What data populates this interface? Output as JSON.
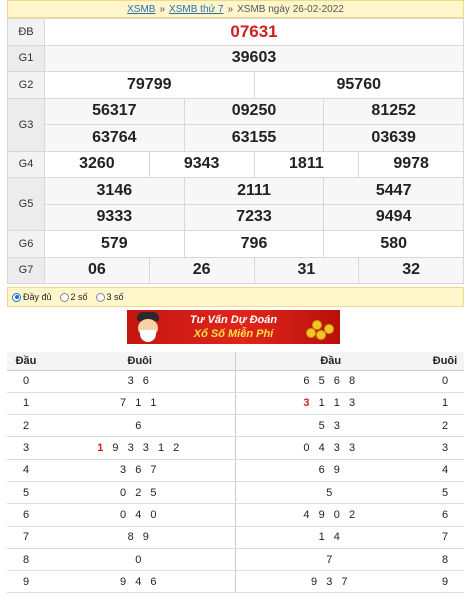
{
  "breadcrumb": {
    "link1": "XSMB",
    "sep1": "»",
    "link2": "XSMB thứ 7",
    "sep2": "»",
    "current": "XSMB ngày 26-02-2022"
  },
  "results": {
    "db": {
      "label": "ĐB",
      "values": [
        "07631"
      ]
    },
    "g1": {
      "label": "G1",
      "values": [
        "39603"
      ]
    },
    "g2": {
      "label": "G2",
      "values": [
        "79799",
        "95760"
      ]
    },
    "g3": {
      "label": "G3",
      "row1": [
        "56317",
        "09250",
        "81252"
      ],
      "row2": [
        "63764",
        "63155",
        "03639"
      ]
    },
    "g4": {
      "label": "G4",
      "values": [
        "3260",
        "9343",
        "1811",
        "9978"
      ]
    },
    "g5": {
      "label": "G5",
      "row1": [
        "3146",
        "2111",
        "5447"
      ],
      "row2": [
        "9333",
        "7233",
        "9494"
      ]
    },
    "g6": {
      "label": "G6",
      "values": [
        "579",
        "796",
        "580"
      ]
    },
    "g7": {
      "label": "G7",
      "values": [
        "06",
        "26",
        "31",
        "32"
      ]
    }
  },
  "options": [
    {
      "label": "Đầy đủ",
      "selected": true
    },
    {
      "label": "2 số",
      "selected": false
    },
    {
      "label": "3 số",
      "selected": false
    }
  ],
  "banner": {
    "line1": "Tư Vấn Dự Đoán",
    "line2": "Xổ Số Miễn Phí"
  },
  "loto": {
    "headers": [
      "Đầu",
      "Đuôi",
      "Đầu",
      "Đuôi"
    ],
    "rows": [
      {
        "head": "0",
        "tail": "3 6",
        "rev_head": "6 5 6 8",
        "rev_tail": "0"
      },
      {
        "head": "1",
        "tail": "7 1 1",
        "rev_head": "3 1 1 3",
        "rev_tail": "1"
      },
      {
        "head": "2",
        "tail": "6",
        "rev_head": "5 3",
        "rev_tail": "2"
      },
      {
        "head": "3",
        "tail": "1 9 3 3 1 2",
        "rev_head": "0 4 3 3",
        "rev_tail": "3"
      },
      {
        "head": "4",
        "tail": "3 6 7",
        "rev_head": "6 9",
        "rev_tail": "4"
      },
      {
        "head": "5",
        "tail": "0 2 5",
        "rev_head": "5",
        "rev_tail": "5"
      },
      {
        "head": "6",
        "tail": "0 4 0",
        "rev_head": "4 9 0 2",
        "rev_tail": "6"
      },
      {
        "head": "7",
        "tail": "8 9",
        "rev_head": "1 4",
        "rev_tail": "7"
      },
      {
        "head": "8",
        "tail": "0",
        "rev_head": "7",
        "rev_tail": "8"
      },
      {
        "head": "9",
        "tail": "9 4 6",
        "rev_head": "9 3 7",
        "rev_tail": "9"
      }
    ],
    "highlight": {
      "tail_row": 3,
      "tail_first": "1",
      "rev_row": 1,
      "rev_first": "3"
    }
  },
  "colors": {
    "special": "#d21e1e",
    "link": "#2a6fb0",
    "bar": "#fff6cc"
  }
}
